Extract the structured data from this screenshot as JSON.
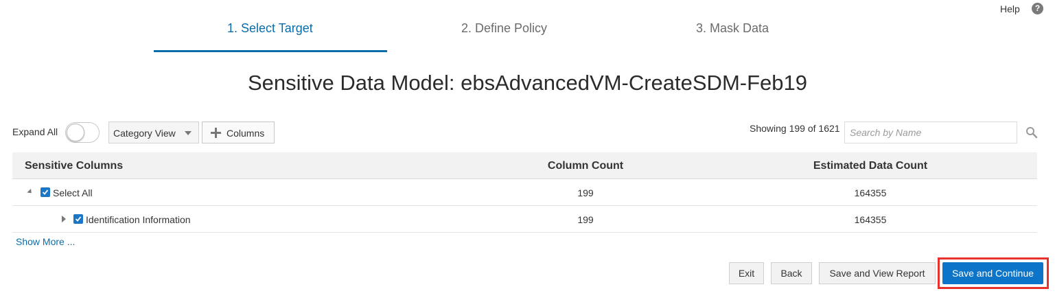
{
  "header": {
    "help_label": "Help",
    "help_icon": "question-circle-icon"
  },
  "wizard": {
    "steps": [
      {
        "label": "1. Select Target",
        "active": true
      },
      {
        "label": "2. Define Policy",
        "active": false
      },
      {
        "label": "3. Mask Data",
        "active": false
      }
    ],
    "accent_color": "#0a6ca8"
  },
  "page_title": "Sensitive Data Model: ebsAdvancedVM-CreateSDM-Feb19",
  "toolbar": {
    "expand_all_label": "Expand All",
    "expand_all_on": false,
    "view_select_value": "Category View",
    "columns_button_label": "Columns",
    "showing_text": "Showing 199 of 1621",
    "search_placeholder": "Search by Name",
    "search_icon": "magnifier-icon"
  },
  "table": {
    "headers": [
      "Sensitive Columns",
      "Column Count",
      "Estimated Data Count"
    ],
    "rows": [
      {
        "label": "Select All",
        "column_count": "199",
        "estimated_data_count": "164355",
        "checked": true,
        "expanded": true
      },
      {
        "label": "Identification Information",
        "column_count": "199",
        "estimated_data_count": "164355",
        "checked": true,
        "expanded": false
      }
    ]
  },
  "show_more_label": "Show More ...",
  "footer": {
    "exit_label": "Exit",
    "back_label": "Back",
    "save_view_report_label": "Save and View Report",
    "save_continue_label": "Save and Continue",
    "primary_color": "#0c74c9",
    "highlight_color": "#e8312a"
  }
}
